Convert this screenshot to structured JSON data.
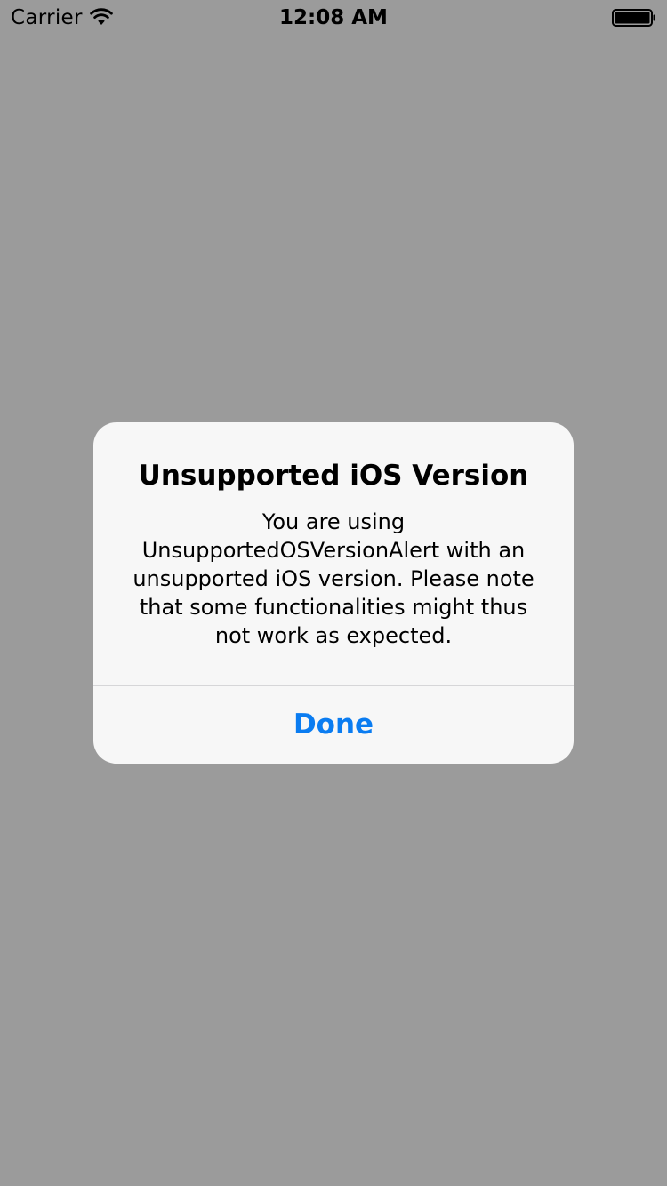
{
  "status_bar": {
    "carrier": "Carrier",
    "time": "12:08 AM",
    "wifi_icon": "wifi-icon",
    "battery_icon": "battery-icon",
    "battery_level": 1.0
  },
  "background": {
    "color": "#9b9b9b"
  },
  "alert": {
    "title": "Unsupported iOS Version",
    "message_lines": [
      "You are using",
      "UnsupportedOSVersionAlert with an",
      "unsupported iOS version. Please note",
      "that some functionalities might thus",
      "not work as expected."
    ],
    "button_label": "Done",
    "accent_color": "#0a7cf1"
  }
}
